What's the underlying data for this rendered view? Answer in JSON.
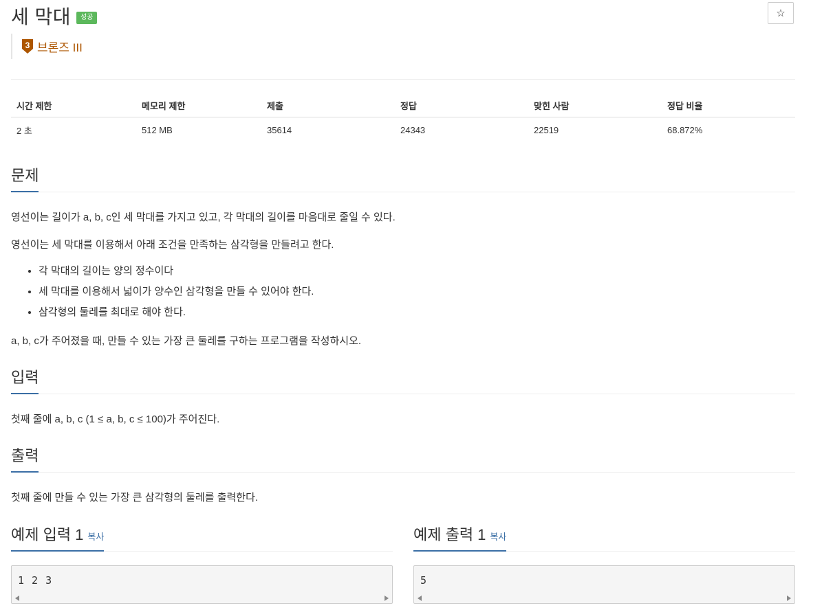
{
  "problem": {
    "title": "세 막대",
    "status_badge": "성공",
    "star_icon": "☆",
    "tier": {
      "number": "3",
      "label": "브론즈 III",
      "color": "#ad5600"
    }
  },
  "stats": {
    "headers": [
      "시간 제한",
      "메모리 제한",
      "제출",
      "정답",
      "맞힌 사람",
      "정답 비율"
    ],
    "values": [
      "2 초",
      "512 MB",
      "35614",
      "24343",
      "22519",
      "68.872%"
    ]
  },
  "sections": {
    "description": {
      "title": "문제",
      "p1": "영선이는 길이가 a, b, c인 세 막대를 가지고 있고, 각 막대의 길이를 마음대로 줄일 수 있다.",
      "p2": "영선이는 세 막대를 이용해서 아래 조건을 만족하는 삼각형을 만들려고 한다.",
      "bullets": [
        "각 막대의 길이는 양의 정수이다",
        "세 막대를 이용해서 넓이가 양수인 삼각형을 만들 수 있어야 한다.",
        "삼각형의 둘레를 최대로 해야 한다."
      ],
      "p3": "a, b, c가 주어졌을 때, 만들 수 있는 가장 큰 둘레를 구하는 프로그램을 작성하시오."
    },
    "input": {
      "title": "입력",
      "text": "첫째 줄에 a, b, c (1 ≤ a, b, c ≤ 100)가 주어진다."
    },
    "output": {
      "title": "출력",
      "text": "첫째 줄에 만들 수 있는 가장 큰 삼각형의 둘레를 출력한다."
    }
  },
  "samples": {
    "input": {
      "title": "예제 입력 1",
      "copy": "복사",
      "content": "1 2 3"
    },
    "output": {
      "title": "예제 출력 1",
      "copy": "복사",
      "content": "5"
    }
  },
  "colors": {
    "accent": "#3a6ea5",
    "badge": "#5cb85c",
    "tier": "#ad5600"
  }
}
